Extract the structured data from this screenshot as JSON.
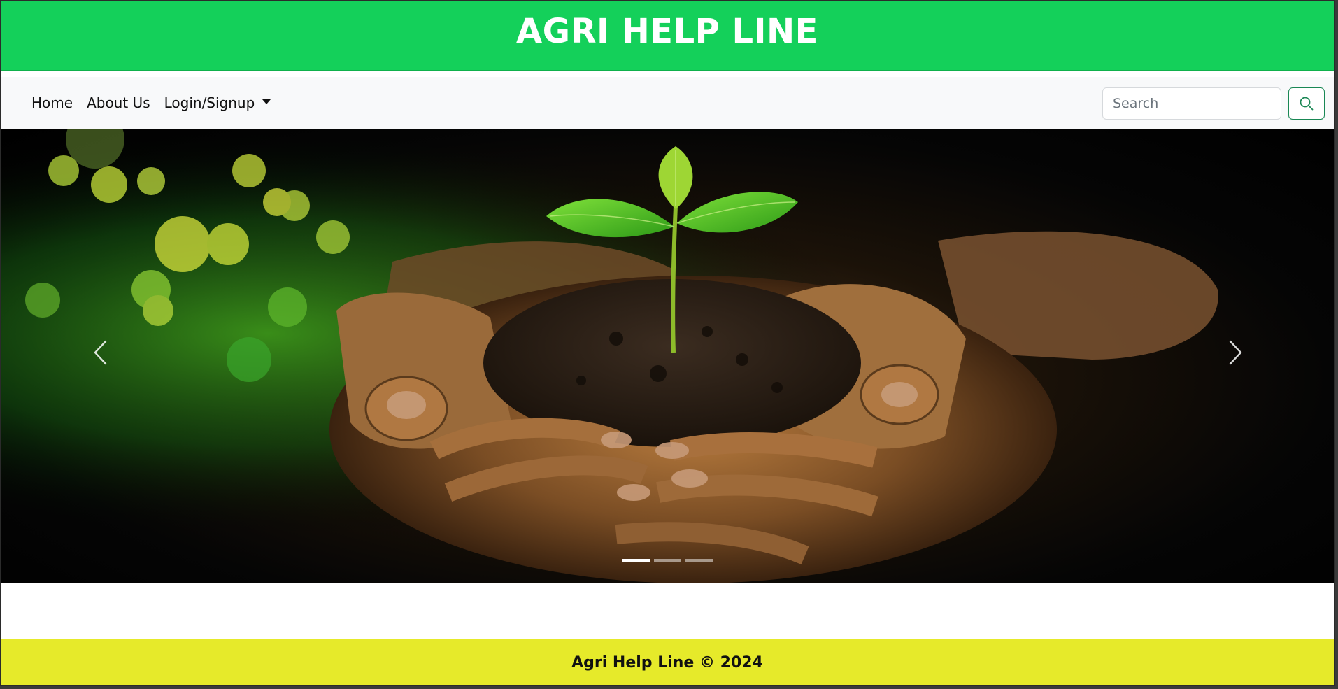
{
  "header": {
    "title": "AGRI HELP LINE",
    "color": "#14d05a"
  },
  "nav": {
    "items": [
      {
        "label": "Home"
      },
      {
        "label": "About Us"
      },
      {
        "label": "Login/Signup",
        "dropdown": true
      }
    ],
    "search": {
      "placeholder": "Search",
      "icon": "search-icon",
      "accent": "#198754"
    }
  },
  "carousel": {
    "slide_image": "hands-holding-seedling-in-soil",
    "prev_icon": "chevron-left-icon",
    "next_icon": "chevron-right-icon",
    "slide_count": 3,
    "active_index": 0
  },
  "footer": {
    "text": "Agri Help Line © 2024",
    "color": "#e6ea2a"
  }
}
